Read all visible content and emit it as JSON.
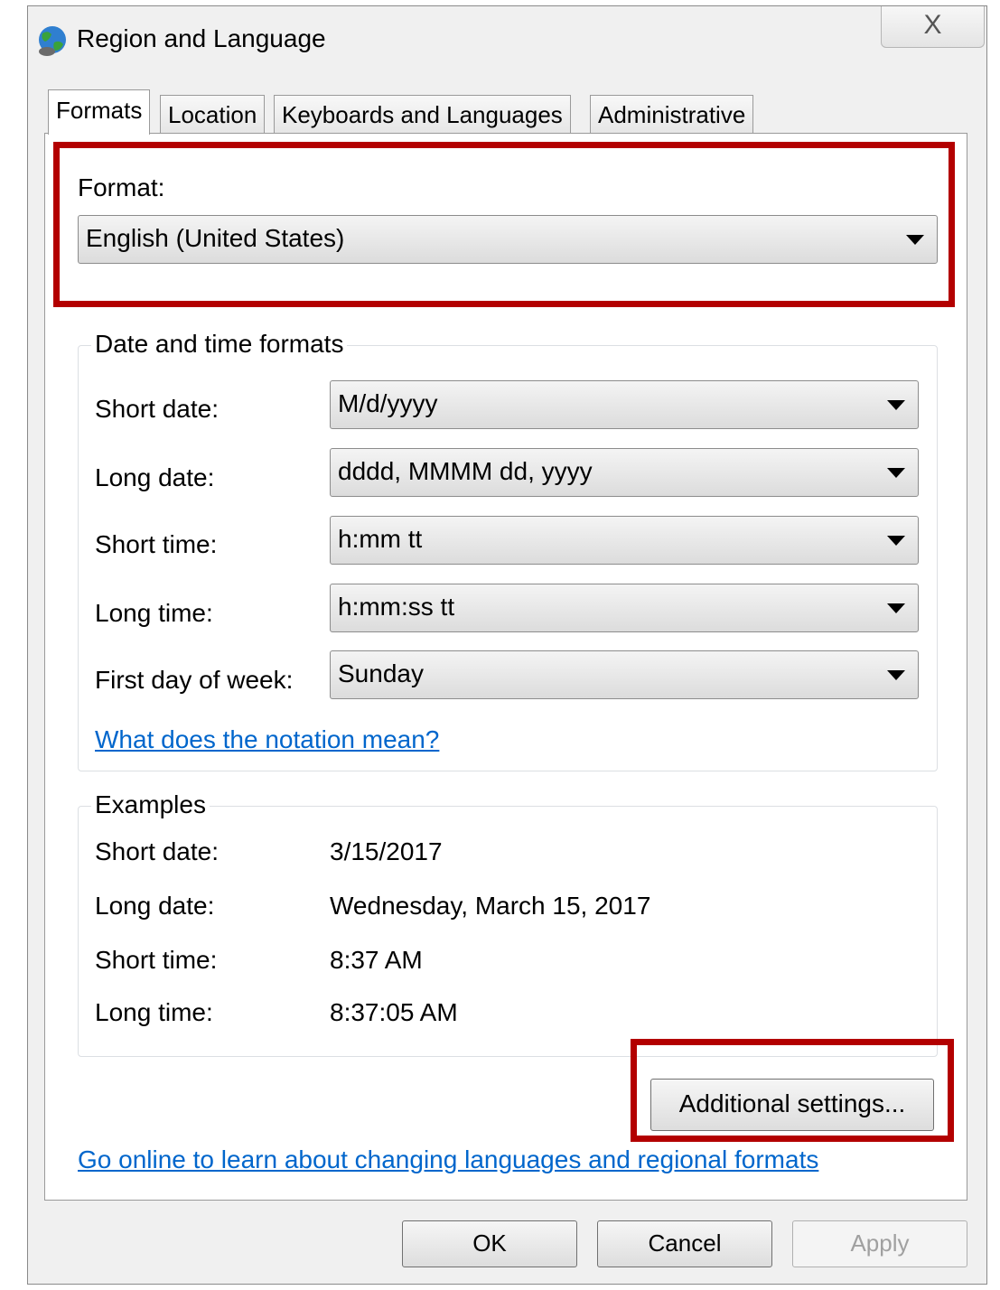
{
  "window": {
    "title": "Region and Language",
    "close_symbol": "X",
    "icon": "globe-icon"
  },
  "tabs": [
    {
      "label": "Formats",
      "active": true
    },
    {
      "label": "Location",
      "active": false
    },
    {
      "label": "Keyboards and Languages",
      "active": false
    },
    {
      "label": "Administrative",
      "active": false
    }
  ],
  "format": {
    "label": "Format:",
    "value": "English (United States)"
  },
  "date_time_formats": {
    "legend": "Date and time formats",
    "rows": [
      {
        "label": "Short date:",
        "value": "M/d/yyyy"
      },
      {
        "label": "Long date:",
        "value": "dddd, MMMM dd, yyyy"
      },
      {
        "label": "Short time:",
        "value": "h:mm tt"
      },
      {
        "label": "Long time:",
        "value": "h:mm:ss tt"
      },
      {
        "label": "First day of week:",
        "value": "Sunday"
      }
    ],
    "notation_link": "What does the notation mean?"
  },
  "examples": {
    "legend": "Examples",
    "rows": [
      {
        "label": "Short date:",
        "value": "3/15/2017"
      },
      {
        "label": "Long date:",
        "value": "Wednesday, March 15, 2017"
      },
      {
        "label": "Short time:",
        "value": "8:37 AM"
      },
      {
        "label": "Long time:",
        "value": "8:37:05 AM"
      }
    ]
  },
  "additional_settings_label": "Additional settings...",
  "online_link": "Go online to learn about changing languages and regional formats",
  "buttons": {
    "ok": "OK",
    "cancel": "Cancel",
    "apply": "Apply"
  },
  "colors": {
    "highlight": "#b30000",
    "link": "#0066cc"
  }
}
